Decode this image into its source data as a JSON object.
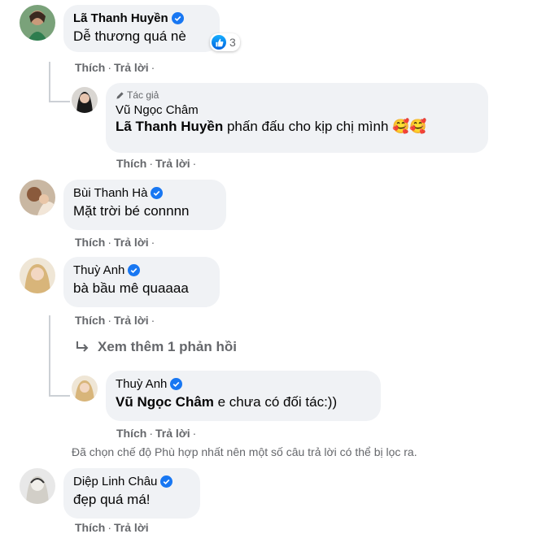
{
  "comments": [
    {
      "name": "Lã Thanh Huyền",
      "text": "Dễ thương quá nè",
      "reaction_count": "3"
    },
    {
      "author_tag": "Tác giả",
      "name": "Vũ Ngọc Châm",
      "mention": "Lã Thanh Huyền",
      "text": " phấn đấu cho kịp chị mình ",
      "emoji": "🥰🥰"
    },
    {
      "name": "Bùi Thanh Hà",
      "text": "Mặt trời bé connnn"
    },
    {
      "name": "Thuỳ Anh",
      "text": "bà bầu mê quaaaa"
    },
    {
      "name": "Thuỳ Anh",
      "mention": "Vũ Ngọc Châm",
      "text": " e chưa có đối tác:))"
    },
    {
      "name": "Diệp Linh Châu",
      "text": "đẹp quá má!"
    }
  ],
  "actions": {
    "like": "Thích",
    "reply": "Trả lời",
    "separator": "·"
  },
  "more_replies": "Xem thêm 1 phản hồi",
  "filter_note": "Đã chọn chế độ Phù hợp nhất nên một số câu trả lời có thể bị lọc ra.",
  "colors": {
    "bubble": "#f0f2f5",
    "verified": "#1877f2",
    "meta": "#65676b"
  }
}
